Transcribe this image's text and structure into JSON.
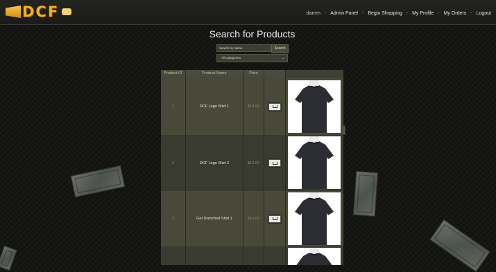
{
  "brand": {
    "logo_text": "DCF"
  },
  "nav": {
    "user": "darren",
    "links": [
      "Admin Panel",
      "Begin Shopping",
      "My Profile",
      "My Orders",
      "Logout"
    ],
    "separator": "-"
  },
  "search": {
    "title": "Search for Products",
    "placeholder": "Search by Name",
    "button": "Search",
    "category": "All Categories"
  },
  "table": {
    "headers": [
      "Product ID",
      "Product Name",
      "Price",
      ""
    ],
    "rows": [
      {
        "id": "1",
        "name": "DCF Logo Shirt 1",
        "price": "$18.00"
      },
      {
        "id": "2",
        "name": "DCF Logo Shirt 2",
        "price": "$19.00"
      },
      {
        "id": "3",
        "name": "Get Drenched Shirt 1",
        "price": "$10.00"
      }
    ]
  },
  "colors": {
    "accent": "#f1b21c",
    "header_text": "#c9c68a",
    "background": "#151513"
  },
  "icons": {
    "cart_button": "cart-icon",
    "chevron": "chevron-down-icon"
  }
}
